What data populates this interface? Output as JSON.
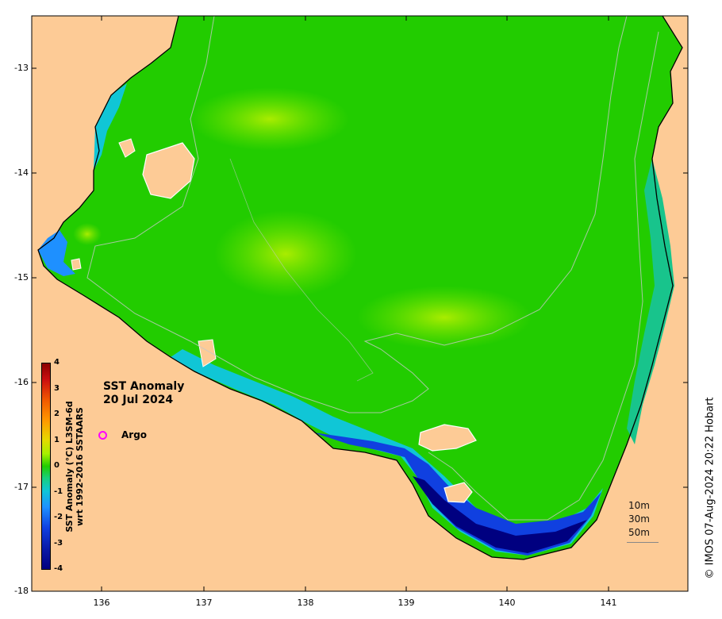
{
  "map": {
    "title_line1": "SST Anomaly",
    "title_line2": "20 Jul 2024",
    "legend_argo": "Argo",
    "copyright": "© IMOS 07-Aug-2024 20:22 Hobart",
    "colorbar_label_line1": "SST Anomaly (°C) L3SM-6d",
    "colorbar_label_line2": "wrt 1992-2016 SSTAARS",
    "colorbar_ticks": [
      "4",
      "3",
      "2",
      "1",
      "0",
      "-1",
      "-2",
      "-3",
      "-4"
    ],
    "lat_ticks": [
      "-13",
      "-14",
      "-15",
      "-16",
      "-17",
      "-18"
    ],
    "lon_ticks": [
      "136",
      "137",
      "138",
      "139",
      "140",
      "141"
    ],
    "depth_contours": [
      "10m",
      "30m",
      "50m"
    ],
    "colors": {
      "land": "#fdcb96",
      "anomaly_zero": "#22cc00",
      "anomaly_positive": "#8ef000",
      "anomaly_negative": "#10c6d6",
      "anomaly_strong_negative": "#000080",
      "argo_marker": "#ff00ff"
    }
  }
}
